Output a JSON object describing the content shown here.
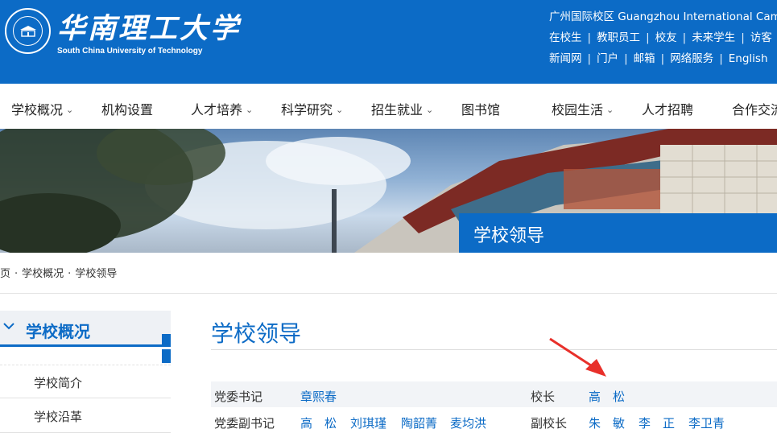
{
  "header": {
    "logo_cn": "华南理工大学",
    "logo_en": "South China University of Technology",
    "campus": "广州国际校区  Guangzhou International Campus",
    "links_row1": [
      "在校生",
      "教职员工",
      "校友",
      "未来学生",
      "访客"
    ],
    "links_row2": [
      "新闻网",
      "门户",
      "邮箱",
      "网络服务",
      "English"
    ]
  },
  "nav": {
    "items": [
      {
        "label": "学校概况",
        "dropdown": true
      },
      {
        "label": "机构设置",
        "dropdown": false
      },
      {
        "label": "人才培养",
        "dropdown": true
      },
      {
        "label": "科学研究",
        "dropdown": true
      },
      {
        "label": "招生就业",
        "dropdown": true
      },
      {
        "label": "图书馆",
        "dropdown": false
      },
      {
        "label": "校园生活",
        "dropdown": true
      },
      {
        "label": "人才招聘",
        "dropdown": false
      },
      {
        "label": "合作交流",
        "dropdown": false
      }
    ]
  },
  "banner": {
    "title": "学校领导"
  },
  "breadcrumb": [
    "首页",
    "学校概况",
    "学校领导"
  ],
  "sidebar": {
    "heading": "学校概况",
    "items": [
      "学校简介",
      "学校沿革"
    ]
  },
  "main": {
    "title": "学校领导",
    "rows": [
      {
        "left_label": "党委书记",
        "left_names": [
          "章熙春"
        ],
        "right_label": "校长",
        "right_names": [
          "高　松"
        ]
      },
      {
        "left_label": "党委副书记",
        "left_names": [
          "高　松",
          "刘琪瑾",
          "陶韶菁",
          "麦均洪"
        ],
        "right_label": "副校长",
        "right_names": [
          "朱　敏",
          "李　正",
          "李卫青"
        ]
      }
    ]
  },
  "colors": {
    "brand_blue": "#0c6bc6",
    "annotation_red": "#e8302a"
  }
}
